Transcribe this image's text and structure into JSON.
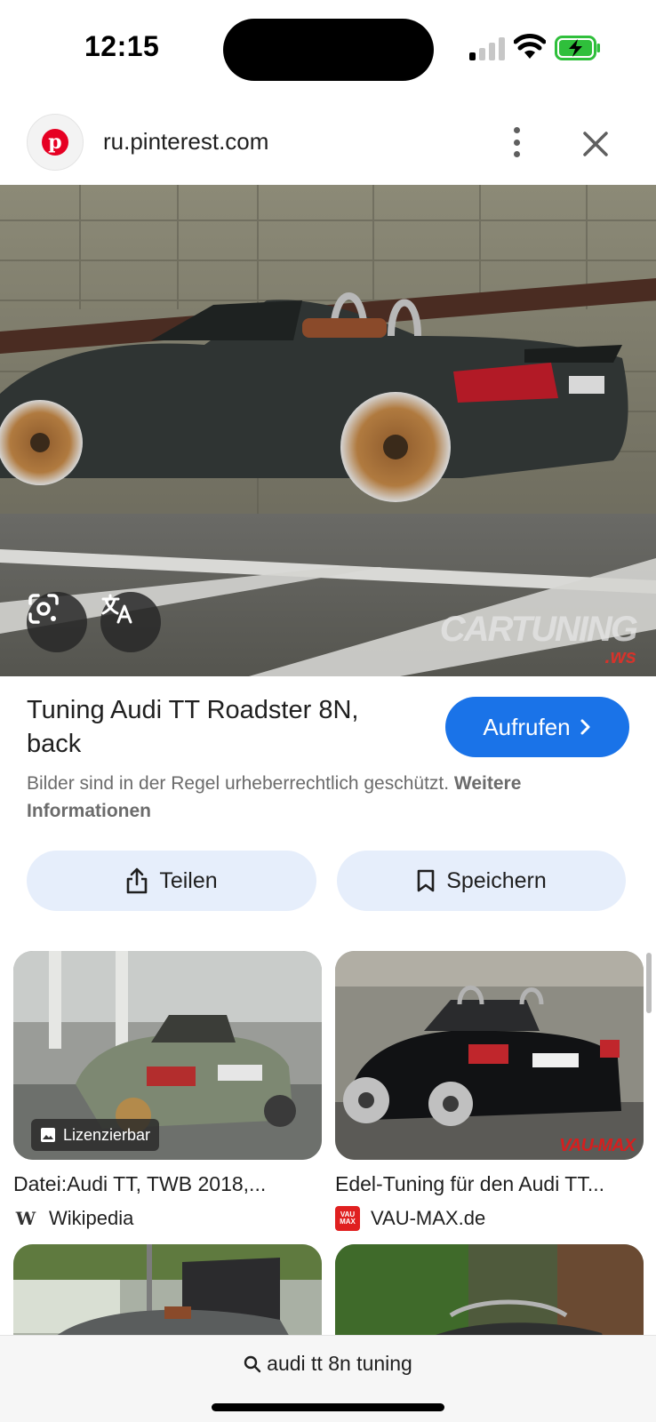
{
  "status_bar": {
    "time": "12:15",
    "icons": [
      "signal-icon",
      "wifi-icon",
      "battery-charging-icon"
    ]
  },
  "browser": {
    "url": "ru.pinterest.com",
    "site_icon": "pinterest-icon",
    "menu_icon": "more-vert-icon",
    "close_icon": "close-icon"
  },
  "hero": {
    "watermark_line1": "CARTUNING",
    "watermark_line2": ".ws",
    "lens_icon": "google-lens-icon",
    "translate_icon": "translate-icon"
  },
  "result": {
    "title": "Tuning Audi TT Roadster 8N, back",
    "visit_label": "Aufrufen",
    "copyright_text": "Bilder sind in der Regel urheberrechtlich geschützt. ",
    "copyright_link": "Weitere Informationen",
    "share_label": "Teilen",
    "save_label": "Speichern"
  },
  "related": [
    {
      "title": "Datei:Audi TT, TWB 2018,...",
      "source": "Wikipedia",
      "badge": "Lizenzierbar",
      "source_icon": "W"
    },
    {
      "title": "Edel-Tuning für den Audi TT...",
      "source": "VAU-MAX.de",
      "watermark": "VAU-MAX",
      "source_icon": "VAU MAX"
    }
  ],
  "search": {
    "query": "audi tt 8n tuning"
  },
  "colors": {
    "accent": "#1a73e8",
    "action_bg": "#e6eefb",
    "pinterest_red": "#e60023"
  }
}
